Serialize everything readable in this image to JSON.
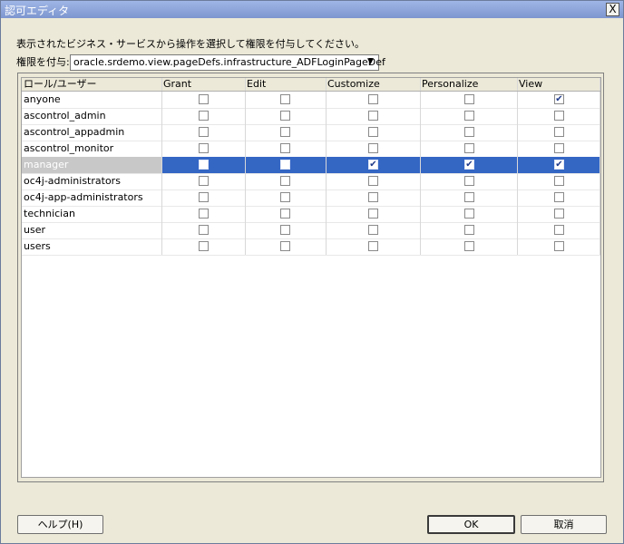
{
  "window": {
    "title": "認可エディタ",
    "close_label": "X"
  },
  "instruction": "表示されたビジネス・サービスから操作を選択して権限を付与してください。",
  "grant_permission": {
    "label": "権限を付与:",
    "selected": "oracle.srdemo.view.pageDefs.infrastructure_ADFLoginPageDef"
  },
  "table": {
    "headers": [
      "ロール/ユーザー",
      "Grant",
      "Edit",
      "Customize",
      "Personalize",
      "View"
    ],
    "selected_row": 4,
    "rows": [
      {
        "name": "anyone",
        "checks": [
          false,
          false,
          false,
          false,
          true
        ]
      },
      {
        "name": "ascontrol_admin",
        "checks": [
          false,
          false,
          false,
          false,
          false
        ]
      },
      {
        "name": "ascontrol_appadmin",
        "checks": [
          false,
          false,
          false,
          false,
          false
        ]
      },
      {
        "name": "ascontrol_monitor",
        "checks": [
          false,
          false,
          false,
          false,
          false
        ]
      },
      {
        "name": "manager",
        "checks": [
          false,
          false,
          true,
          true,
          true
        ]
      },
      {
        "name": "oc4j-administrators",
        "checks": [
          false,
          false,
          false,
          false,
          false
        ]
      },
      {
        "name": "oc4j-app-administrators",
        "checks": [
          false,
          false,
          false,
          false,
          false
        ]
      },
      {
        "name": "technician",
        "checks": [
          false,
          false,
          false,
          false,
          false
        ]
      },
      {
        "name": "user",
        "checks": [
          false,
          false,
          false,
          false,
          false
        ]
      },
      {
        "name": "users",
        "checks": [
          false,
          false,
          false,
          false,
          false
        ]
      }
    ]
  },
  "buttons": {
    "help": "ヘルプ(H)",
    "ok": "OK",
    "cancel": "取消"
  }
}
